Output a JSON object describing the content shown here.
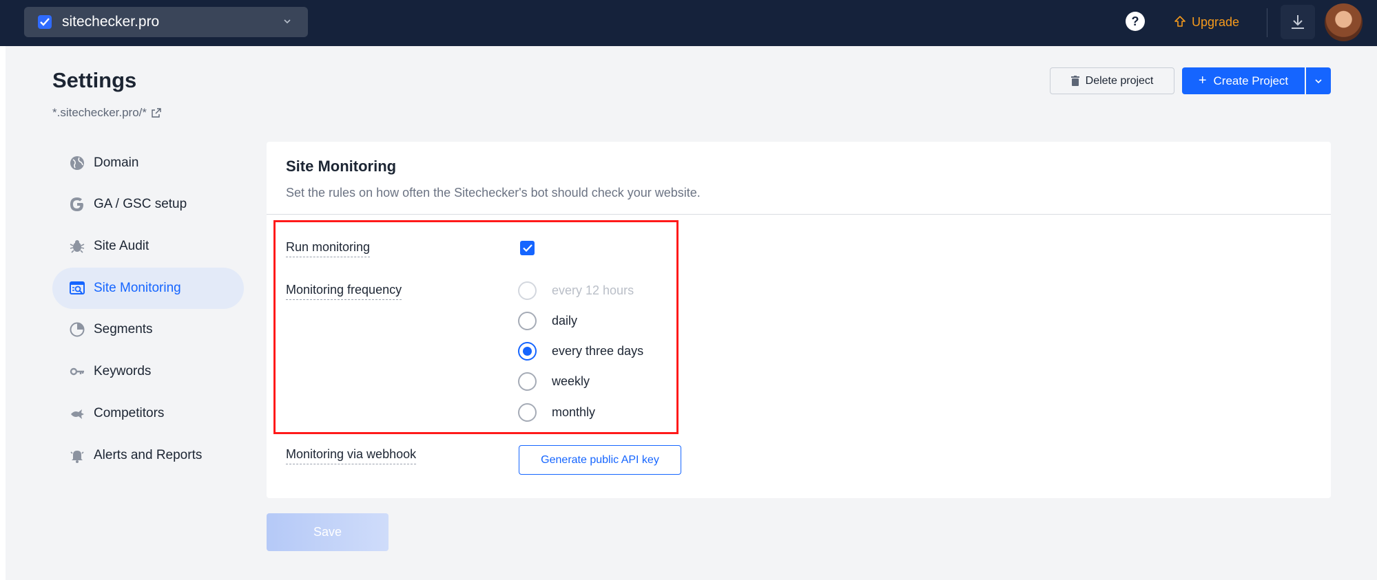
{
  "topbar": {
    "project_name": "sitechecker.pro",
    "upgrade_label": "Upgrade",
    "accent_upgrade": "#f59a1c",
    "background": "#15223b"
  },
  "header": {
    "title": "Settings",
    "url": "*.sitechecker.pro/*",
    "delete_label": "Delete project",
    "create_label": "Create Project",
    "create_plus": "+"
  },
  "sidebar": {
    "items": [
      {
        "label": "Domain",
        "icon": "globe-icon"
      },
      {
        "label": "GA / GSC setup",
        "icon": "google-icon"
      },
      {
        "label": "Site Audit",
        "icon": "bug-icon"
      },
      {
        "label": "Site Monitoring",
        "icon": "monitoring-icon",
        "active": true
      },
      {
        "label": "Segments",
        "icon": "pie-icon"
      },
      {
        "label": "Keywords",
        "icon": "key-icon"
      },
      {
        "label": "Competitors",
        "icon": "fish-icon"
      },
      {
        "label": "Alerts and Reports",
        "icon": "bell-icon"
      }
    ]
  },
  "card": {
    "title": "Site Monitoring",
    "description": "Set the rules on how often the Sitechecker's bot should check your website.",
    "run_monitoring_label": "Run monitoring",
    "run_monitoring_checked": true,
    "frequency_label": "Monitoring frequency",
    "frequency_options": [
      {
        "label": "every 12 hours",
        "disabled": true,
        "checked": false
      },
      {
        "label": "daily",
        "disabled": false,
        "checked": false
      },
      {
        "label": "every three days",
        "disabled": false,
        "checked": true
      },
      {
        "label": "weekly",
        "disabled": false,
        "checked": false
      },
      {
        "label": "monthly",
        "disabled": false,
        "checked": false
      }
    ],
    "webhook_label": "Monitoring via webhook",
    "api_key_button": "Generate public API key"
  },
  "footer": {
    "save_label": "Save"
  },
  "colors": {
    "primary": "#1565ff",
    "highlight": "#ff1a1a"
  }
}
